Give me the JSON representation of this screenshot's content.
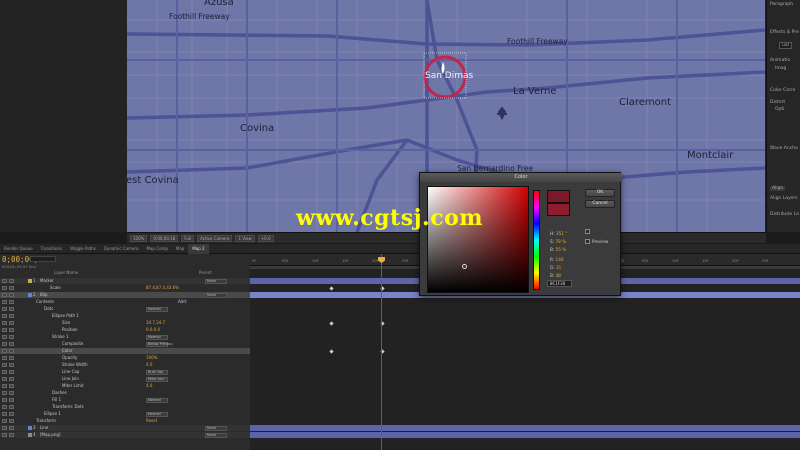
{
  "map": {
    "cities": {
      "azusa": "Azusa",
      "san_dimas": "San Dimas",
      "la_verne": "La Verne",
      "claremont": "Claremont",
      "covina": "Covina",
      "west_covina": "est Covina",
      "montclair": "Montclair"
    },
    "freeways": {
      "foothill_top": "Foothill Freeway",
      "foothill_right": "Foothill Freeway",
      "san_bernardino": "San Bernardino Free"
    }
  },
  "right_panel": {
    "lines": [
      "Paragraph",
      "Effects & Pre",
      "ual",
      "Animatio",
      "Imag",
      "Color Corre",
      "Distort",
      "Opti",
      "Wave Ancho",
      "Align",
      "Align Layers",
      "Distribute La"
    ]
  },
  "viewer_toolbar": {
    "zoom": "100%",
    "timecode": "0;00;00;18",
    "resolution": "Full",
    "camera": "Active Camera",
    "views": "1 View",
    "offset": "+0.0"
  },
  "tabs": [
    "Render Queue",
    "Transitions",
    "Wiggle Paths",
    "Dynamic Camera",
    "Map Comp",
    "Map",
    "Map 2"
  ],
  "timeline": {
    "timecode": "0;00;00;18",
    "fps": "00018 (29.97 fps)",
    "header_layer_name": "Layer Name",
    "header_parent": "Parent",
    "rows": [
      {
        "num": "1",
        "name": "Marker",
        "parent": "None",
        "kind": "layer"
      },
      {
        "num": "",
        "name": "Scale",
        "value": "87.4,87.4,43.6%",
        "kind": "prop"
      },
      {
        "num": "2",
        "name": "Blip",
        "parent": "None",
        "kind": "layer-sel"
      },
      {
        "num": "",
        "name": "Contents",
        "add": "Add:",
        "kind": "group"
      },
      {
        "num": "",
        "name": "Dots",
        "mode": "Normal",
        "kind": "group2"
      },
      {
        "num": "",
        "name": "Ellipse Path 1",
        "kind": "group3"
      },
      {
        "num": "",
        "name": "Size",
        "value": "34.7,34.7",
        "kind": "prop2"
      },
      {
        "num": "",
        "name": "Position",
        "value": "0.0,0.0",
        "kind": "prop2"
      },
      {
        "num": "",
        "name": "Stroke 1",
        "mode": "Normal",
        "kind": "group3"
      },
      {
        "num": "",
        "name": "Composite",
        "mode": "Below Previou",
        "kind": "prop2"
      },
      {
        "num": "",
        "name": "Color",
        "kind": "prop2-sel"
      },
      {
        "num": "",
        "name": "Opacity",
        "value": "100%",
        "kind": "prop2"
      },
      {
        "num": "",
        "name": "Stroke Width",
        "value": "4.0",
        "kind": "prop2"
      },
      {
        "num": "",
        "name": "Line Cap",
        "mode": "Butt Cap",
        "kind": "prop2"
      },
      {
        "num": "",
        "name": "Line Join",
        "mode": "Miter Join",
        "kind": "prop2"
      },
      {
        "num": "",
        "name": "Miter Limit",
        "value": "4.0",
        "kind": "prop2"
      },
      {
        "num": "",
        "name": "Dashes",
        "kind": "group3"
      },
      {
        "num": "",
        "name": "Fill 1",
        "mode": "Normal",
        "kind": "group3"
      },
      {
        "num": "",
        "name": "Transform: Dots",
        "kind": "group3"
      },
      {
        "num": "",
        "name": "Ellipse 1",
        "mode": "Normal",
        "kind": "group2"
      },
      {
        "num": "",
        "name": "Transform",
        "value": "Reset",
        "kind": "group"
      },
      {
        "num": "3",
        "name": "Line",
        "parent": "None",
        "kind": "layer"
      },
      {
        "num": "4",
        "name": "[Map.png]",
        "parent": "None",
        "kind": "layer"
      }
    ],
    "ruler_ticks": [
      "0f",
      "05f",
      "10f",
      "15f",
      "20f",
      "25f",
      "01:00f",
      "05f",
      "10f",
      "15f",
      "20f",
      "25f",
      "02:00f",
      "05f",
      "10f",
      "15f",
      "20f",
      "25f"
    ]
  },
  "color_dialog": {
    "title": "Color",
    "ok": "OK",
    "cancel": "Cancel",
    "preview_label": "Preview",
    "fields": {
      "h": "H",
      "h_val": "351 °",
      "s": "S",
      "s_val": "78 %",
      "b": "B",
      "b_val": "55 %",
      "r": "R",
      "r_val": "140",
      "g": "G",
      "g_val": "31",
      "bl": "B",
      "bl_val": "48"
    },
    "hex": "8C1F30",
    "new_color": "#7a1a28",
    "current_color": "#8c1c2e"
  },
  "watermark": "www.cgtsj.com"
}
